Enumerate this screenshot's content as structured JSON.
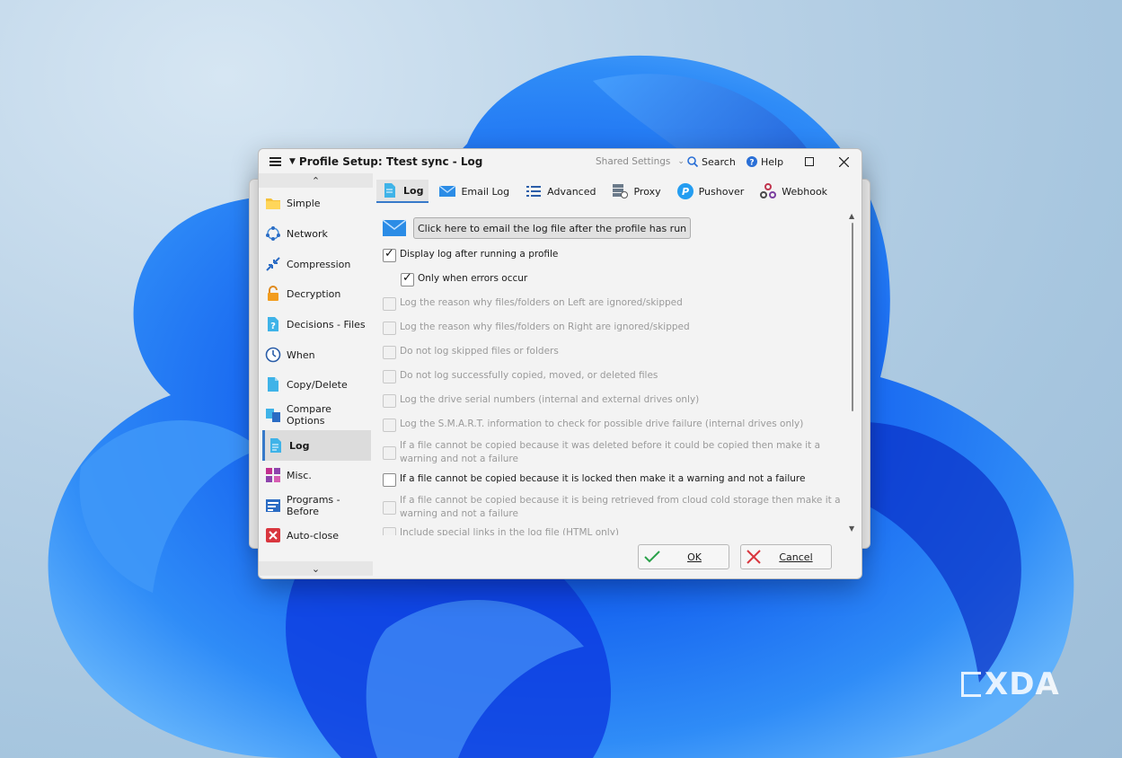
{
  "window": {
    "title": "Profile Setup: Ttest sync - Log",
    "shared_settings": "Shared Settings",
    "search": "Search",
    "help": "Help"
  },
  "sidebar": {
    "items": [
      {
        "label": "Simple",
        "icon": "folder-icon"
      },
      {
        "label": "Network",
        "icon": "network-icon"
      },
      {
        "label": "Compression",
        "icon": "compress-icon"
      },
      {
        "label": "Decryption",
        "icon": "unlock-icon"
      },
      {
        "label": "Decisions - Files",
        "icon": "question-file-icon"
      },
      {
        "label": "When",
        "icon": "clock-icon"
      },
      {
        "label": "Copy/Delete",
        "icon": "file-icon"
      },
      {
        "label": "Compare Options",
        "icon": "compare-icon"
      },
      {
        "label": "Log",
        "icon": "log-icon",
        "selected": true
      },
      {
        "label": "Misc.",
        "icon": "misc-icon"
      },
      {
        "label": "Programs - Before",
        "icon": "programs-icon"
      },
      {
        "label": "Auto-close",
        "icon": "close-red-icon"
      }
    ]
  },
  "tabs": [
    {
      "label": "Log",
      "active": true
    },
    {
      "label": "Email Log"
    },
    {
      "label": "Advanced"
    },
    {
      "label": "Proxy"
    },
    {
      "label": "Pushover"
    },
    {
      "label": "Webhook"
    }
  ],
  "content": {
    "email_button": "Click here to email the log file after the profile has run",
    "options": [
      {
        "text": "Display log after running a profile",
        "checked": true,
        "enabled": true
      },
      {
        "text": "Only when errors occur",
        "checked": true,
        "enabled": true,
        "indent": true
      },
      {
        "text": "Log the reason why files/folders on Left are ignored/skipped",
        "checked": false,
        "enabled": false
      },
      {
        "text": "Log the reason why files/folders on Right are ignored/skipped",
        "checked": false,
        "enabled": false
      },
      {
        "text": "Do not log skipped files or folders",
        "checked": false,
        "enabled": false
      },
      {
        "text": "Do not log successfully copied, moved, or deleted files",
        "checked": false,
        "enabled": false
      },
      {
        "text": "Log the drive serial numbers (internal and external drives only)",
        "checked": false,
        "enabled": false
      },
      {
        "text": "Log the S.M.A.R.T. information to check for possible drive failure (internal drives only)",
        "checked": false,
        "enabled": false
      },
      {
        "text": "If a file cannot be copied because it was deleted before it could be copied then make it a warning and not a failure",
        "checked": false,
        "enabled": false
      },
      {
        "text": "If a file cannot be copied because it is locked then make it a warning and not a failure",
        "checked": false,
        "enabled": true
      },
      {
        "text": "If a file cannot be copied because it is being retrieved from cloud cold storage then make it a warning and not a failure",
        "checked": false,
        "enabled": false
      },
      {
        "text": "Include special links in the log file (HTML only)",
        "checked": false,
        "enabled": false
      }
    ]
  },
  "buttons": {
    "ok": "OK",
    "cancel": "Cancel"
  },
  "watermark": "XDA"
}
